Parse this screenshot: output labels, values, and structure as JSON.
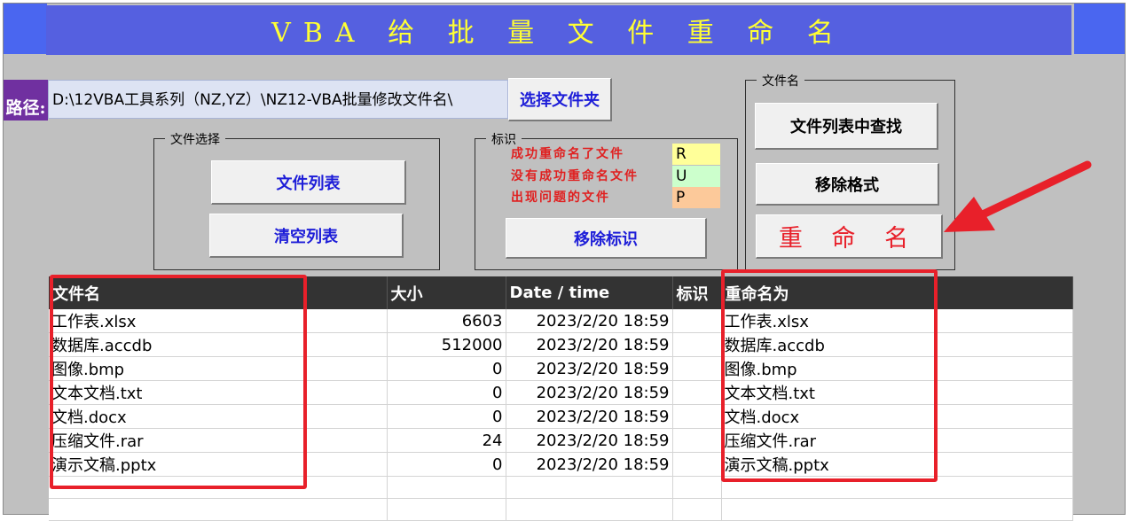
{
  "title": "VBA 给 批 量 文 件 重 命 名",
  "path": {
    "label": "路径:",
    "value": "D:\\12VBA工具系列（NZ,YZ）\\NZ12-VBA批量修改文件名\\"
  },
  "buttons": {
    "select_folder": "选择文件夹",
    "file_list": "文件列表",
    "clear_list": "清空列表",
    "remove_marks": "移除标识",
    "find_in_list": "文件列表中查找",
    "remove_format": "移除格式",
    "rename": "重 命 名"
  },
  "groups": {
    "file_select": "文件选择",
    "marks": "标识",
    "filename": "文件名"
  },
  "legend": [
    {
      "text": "成功重命名了文件",
      "flag": "R",
      "color": "#ffff99"
    },
    {
      "text": "没有成功重命名文件",
      "flag": "U",
      "color": "#ccffcc"
    },
    {
      "text": "出现问题的文件",
      "flag": "P",
      "color": "#fcc99a"
    }
  ],
  "table": {
    "headers": [
      "文件名",
      "大小",
      "Date / time",
      "标识",
      "重命名为"
    ],
    "rows": [
      [
        "工作表.xlsx",
        "6603",
        "2023/2/20 18:59",
        "",
        "工作表.xlsx"
      ],
      [
        "数据库.accdb",
        "512000",
        "2023/2/20 18:59",
        "",
        "数据库.accdb"
      ],
      [
        "图像.bmp",
        "0",
        "2023/2/20 18:59",
        "",
        "图像.bmp"
      ],
      [
        "文本文档.txt",
        "0",
        "2023/2/20 18:59",
        "",
        "文本文档.txt"
      ],
      [
        "文档.docx",
        "0",
        "2023/2/20 18:59",
        "",
        "文档.docx"
      ],
      [
        "压缩文件.rar",
        "24",
        "2023/2/20 18:59",
        "",
        "压缩文件.rar"
      ],
      [
        "演示文稿.pptx",
        "0",
        "2023/2/20 18:59",
        "",
        "演示文稿.pptx"
      ],
      [
        "",
        "",
        "",
        "",
        ""
      ],
      [
        "",
        "",
        "",
        "",
        ""
      ]
    ]
  },
  "colors": {
    "title_bg": "#5560e0",
    "title_text": "#ffff33",
    "highlight_red": "#e8202a",
    "header_bg": "#333333"
  }
}
